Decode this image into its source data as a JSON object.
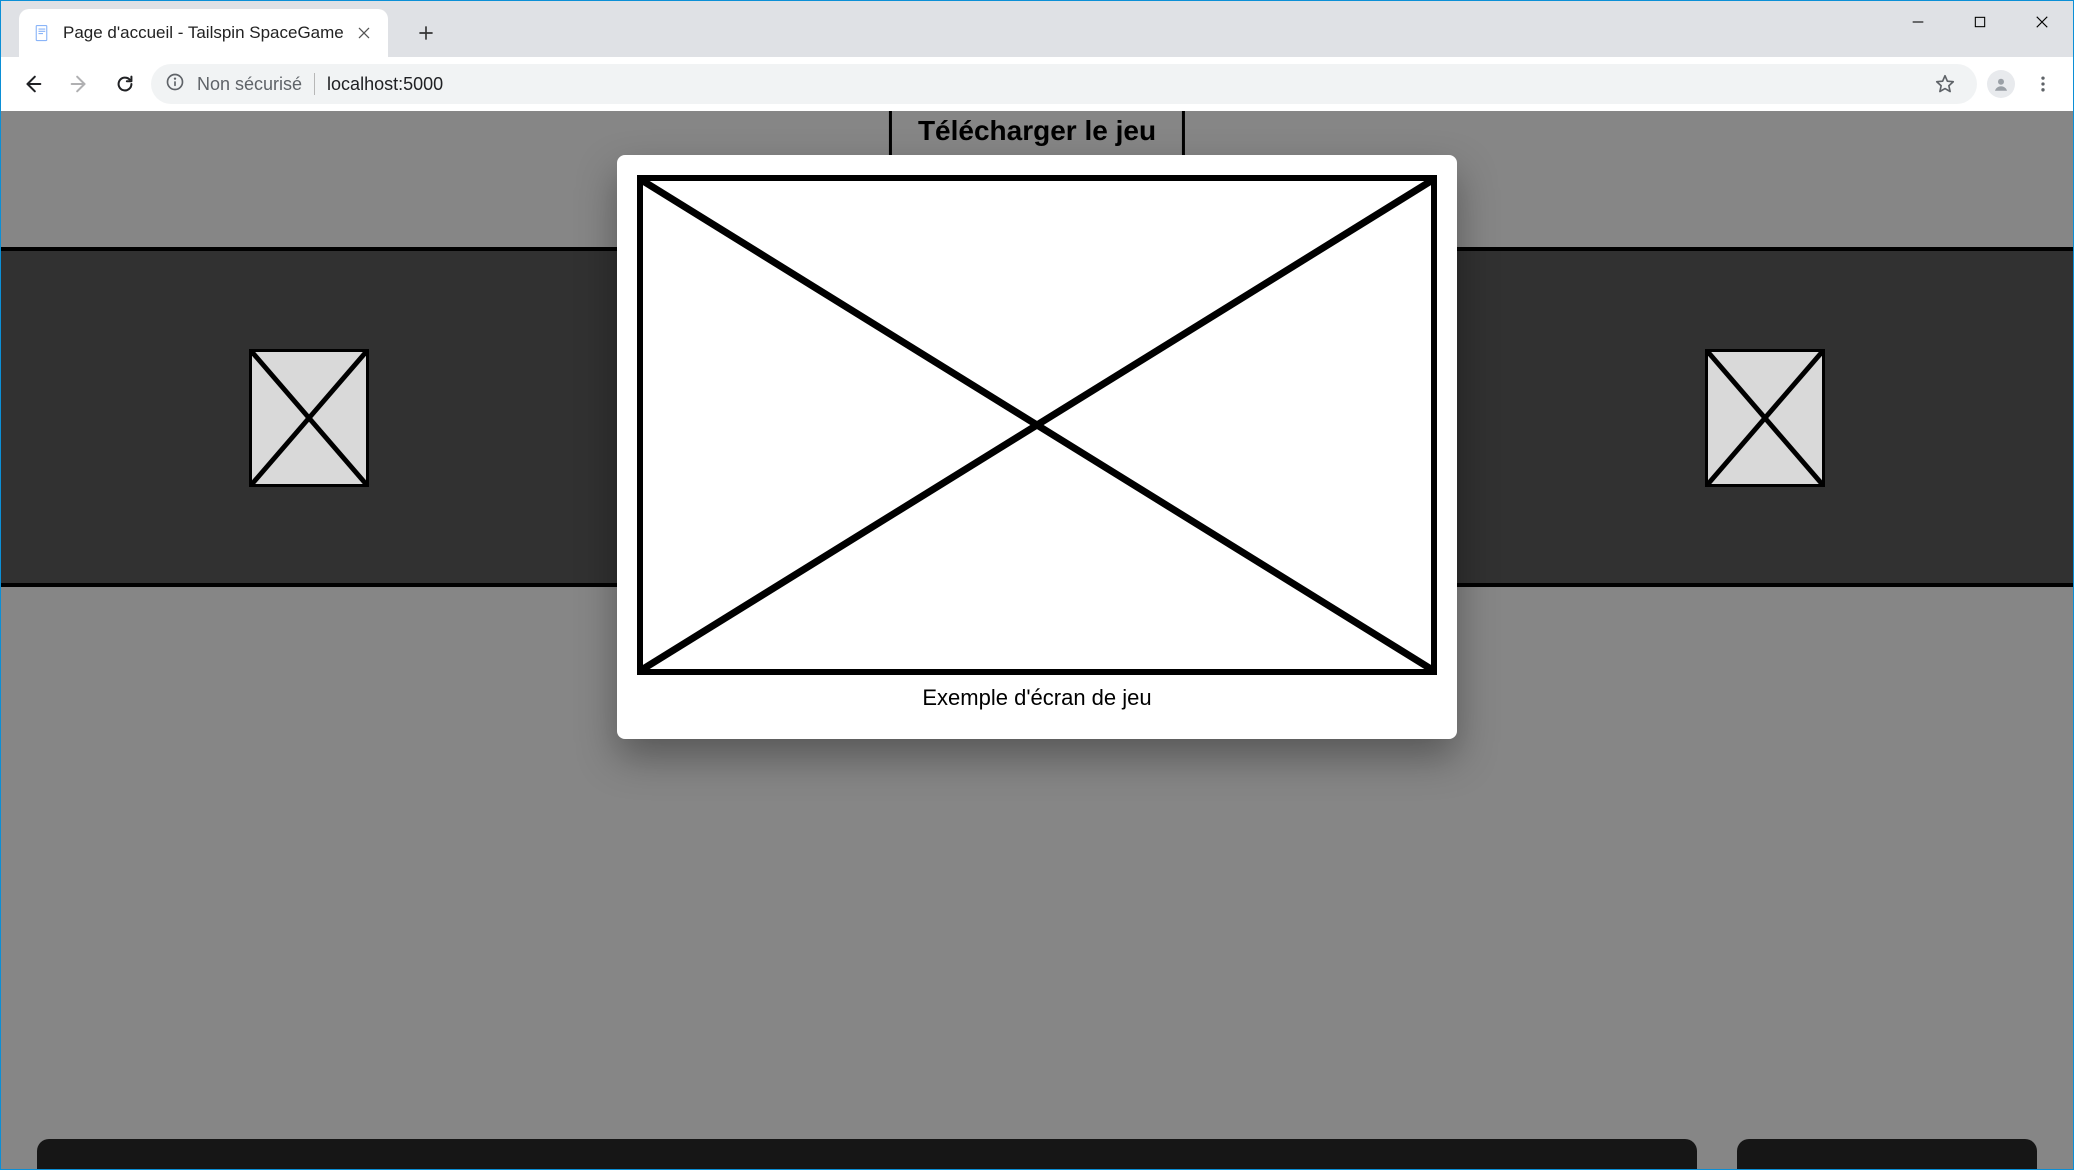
{
  "browser": {
    "tab_title": "Page d'accueil - Tailspin SpaceGame",
    "security_label": "Non sécurisé",
    "url": "localhost:5000"
  },
  "page": {
    "download_label": "Télécharger le jeu",
    "modal_caption": "Exemple d'écran de jeu"
  }
}
